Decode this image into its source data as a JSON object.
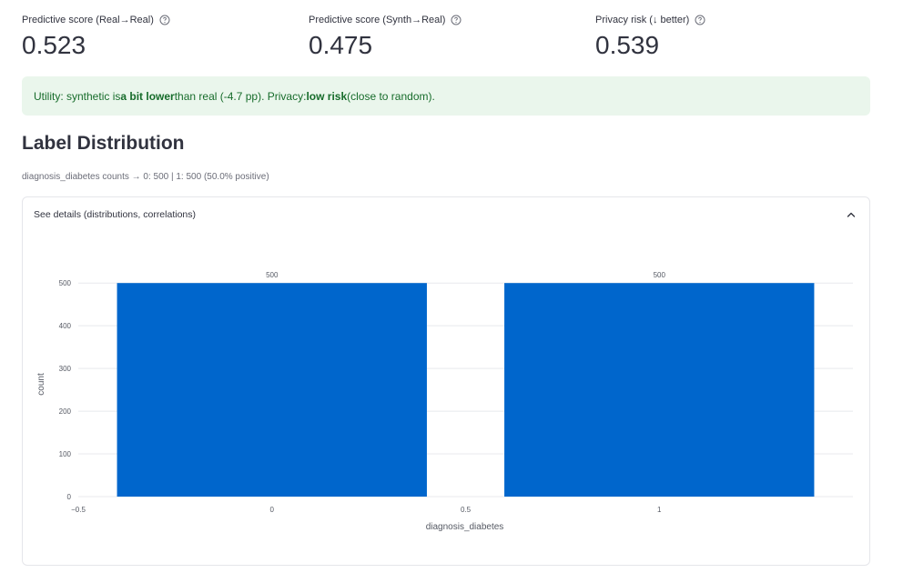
{
  "metrics": [
    {
      "label": "Predictive score (Real→Real)",
      "value": "0.523"
    },
    {
      "label": "Predictive score (Synth→Real)",
      "value": "0.475"
    },
    {
      "label": "Privacy risk (↓ better)",
      "value": "0.539"
    }
  ],
  "alert": {
    "prefix": "Utility: synthetic is ",
    "bold1": "a bit lower",
    "middle": " than real (-4.7 pp). Privacy: ",
    "bold2": "low risk",
    "suffix": " (close to random)."
  },
  "section_title": "Label Distribution",
  "caption": "diagnosis_diabetes counts → 0: 500 | 1: 500 (50.0% positive)",
  "expander": {
    "title": "See details (distributions, correlations)"
  },
  "colors": {
    "bar": "#0066cc",
    "alert_bg": "#eaf6ec",
    "alert_text": "#176c2b",
    "grid": "#e8e9ed"
  },
  "icons": {
    "help": "question-circle-icon",
    "collapse": "chevron-up-icon"
  },
  "chart_data": {
    "type": "bar",
    "categories": [
      0,
      1
    ],
    "values": [
      500,
      500
    ],
    "data_labels": [
      "500",
      "500"
    ],
    "xlabel": "diagnosis_diabetes",
    "ylabel": "count",
    "xlim": [
      -0.5,
      1.5
    ],
    "ylim": [
      0,
      526
    ],
    "x_ticks": [
      -0.5,
      0,
      0.5,
      1
    ],
    "x_tick_labels": [
      "−0.5",
      "0",
      "0.5",
      "1"
    ],
    "y_ticks": [
      0,
      100,
      200,
      300,
      400,
      500
    ],
    "bar_width": 0.8,
    "grid": true
  }
}
